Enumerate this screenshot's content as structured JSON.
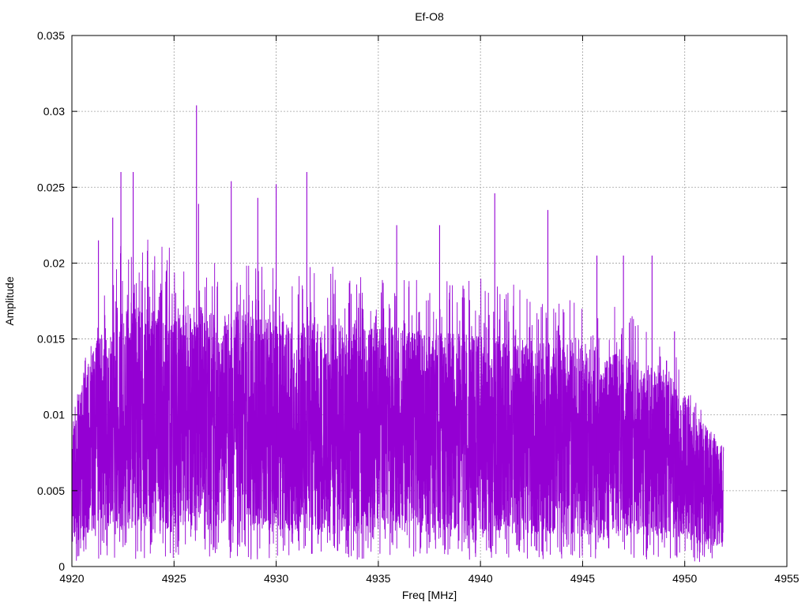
{
  "chart_data": {
    "type": "line",
    "title": "Ef-O8",
    "xlabel": "Freq [MHz]",
    "ylabel": "Amplitude",
    "xlim": [
      4920,
      4955
    ],
    "ylim": [
      0,
      0.035
    ],
    "x_ticks": [
      {
        "value": 4920,
        "label": "4920"
      },
      {
        "value": 4925,
        "label": "4925"
      },
      {
        "value": 4930,
        "label": "4930"
      },
      {
        "value": 4935,
        "label": "4935"
      },
      {
        "value": 4940,
        "label": "4940"
      },
      {
        "value": 4945,
        "label": "4945"
      },
      {
        "value": 4950,
        "label": "4950"
      },
      {
        "value": 4955,
        "label": "4955"
      }
    ],
    "y_ticks": [
      {
        "value": 0,
        "label": "0"
      },
      {
        "value": 0.005,
        "label": "0.005"
      },
      {
        "value": 0.01,
        "label": "0.01"
      },
      {
        "value": 0.015,
        "label": "0.015"
      },
      {
        "value": 0.02,
        "label": "0.02"
      },
      {
        "value": 0.025,
        "label": "0.025"
      },
      {
        "value": 0.03,
        "label": "0.03"
      },
      {
        "value": 0.035,
        "label": "0.035"
      }
    ],
    "grid": true,
    "line_color": "#9400d3",
    "series": [
      {
        "x_range": [
          4920,
          4951.9
        ],
        "note_shape": "dense noisy amplitude spectrum",
        "envelope": {
          "x": [
            4920,
            4920.5,
            4921,
            4921.5,
            4922,
            4923,
            4925,
            4928,
            4932,
            4936,
            4940,
            4944,
            4947,
            4949,
            4950,
            4951,
            4951.9
          ],
          "mean": [
            0.0055,
            0.0075,
            0.0085,
            0.009,
            0.0095,
            0.0098,
            0.0097,
            0.0095,
            0.0092,
            0.009,
            0.0087,
            0.0084,
            0.008,
            0.0075,
            0.0065,
            0.0055,
            0.0045
          ],
          "upper": [
            0.01,
            0.013,
            0.016,
            0.019,
            0.021,
            0.022,
            0.021,
            0.02,
            0.02,
            0.019,
            0.019,
            0.018,
            0.017,
            0.016,
            0.013,
            0.01,
            0.008
          ]
        },
        "peaks": [
          {
            "x": 4926.1,
            "y": 0.0304
          },
          {
            "x": 4922.4,
            "y": 0.026
          },
          {
            "x": 4923.0,
            "y": 0.026
          },
          {
            "x": 4931.5,
            "y": 0.026
          },
          {
            "x": 4927.8,
            "y": 0.0254
          },
          {
            "x": 4930.0,
            "y": 0.0252
          },
          {
            "x": 4940.7,
            "y": 0.0246
          },
          {
            "x": 4926.2,
            "y": 0.0239
          },
          {
            "x": 4943.3,
            "y": 0.0235
          },
          {
            "x": 4922.0,
            "y": 0.023
          },
          {
            "x": 4929.1,
            "y": 0.0243
          },
          {
            "x": 4935.9,
            "y": 0.0225
          },
          {
            "x": 4938.0,
            "y": 0.0225
          },
          {
            "x": 4921.3,
            "y": 0.0215
          },
          {
            "x": 4947.0,
            "y": 0.0205
          },
          {
            "x": 4945.7,
            "y": 0.0205
          },
          {
            "x": 4948.4,
            "y": 0.0205
          },
          {
            "x": 4949.5,
            "y": 0.0155
          }
        ]
      }
    ]
  }
}
